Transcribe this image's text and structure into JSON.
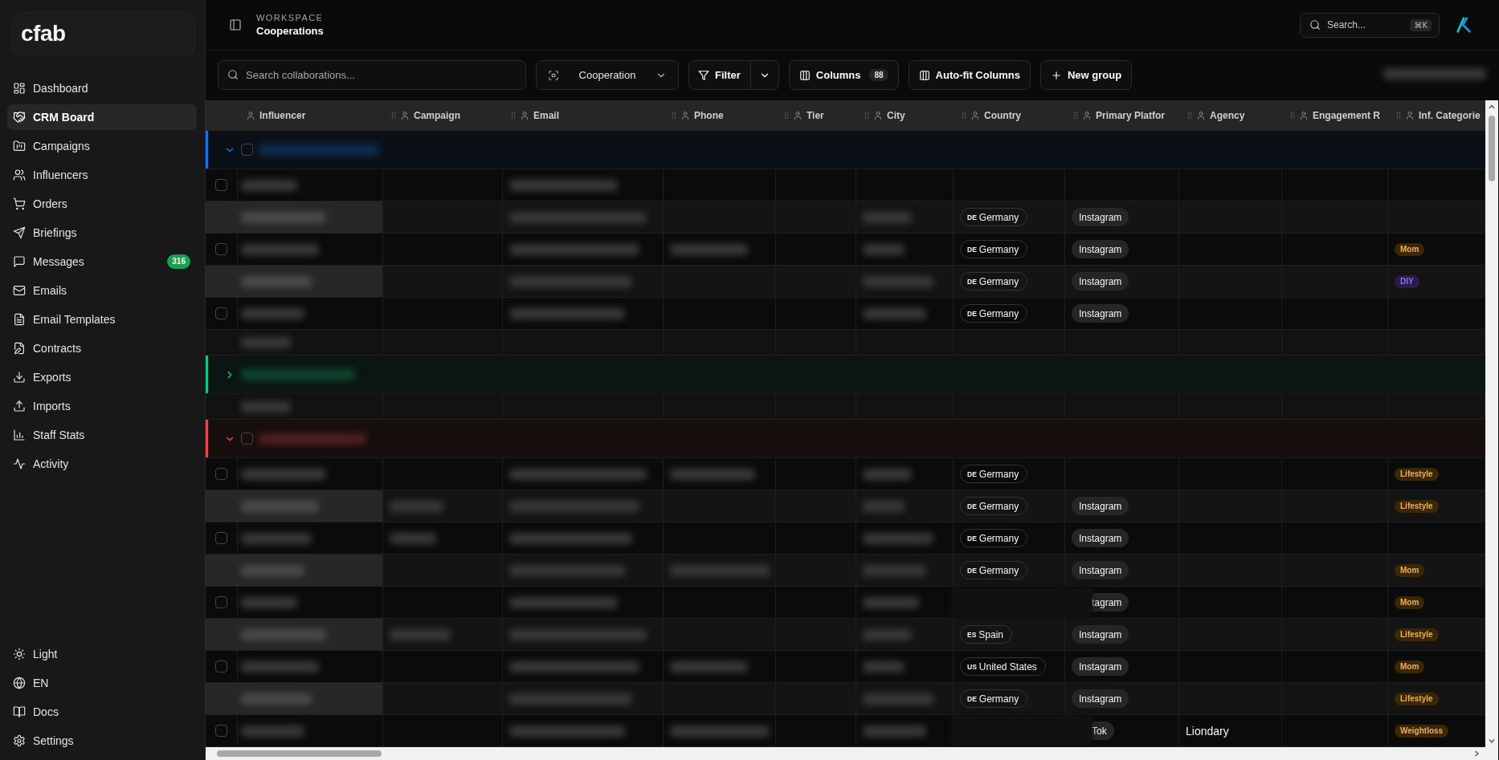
{
  "sidebar": {
    "logo": "cfab",
    "nav": [
      {
        "label": "Dashboard",
        "selected": false
      },
      {
        "label": "CRM Board",
        "selected": true
      },
      {
        "label": "Campaigns",
        "selected": false
      },
      {
        "label": "Influencers",
        "selected": false
      },
      {
        "label": "Orders",
        "selected": false
      },
      {
        "label": "Briefings",
        "selected": false
      },
      {
        "label": "Messages",
        "selected": false,
        "badge": "316"
      },
      {
        "label": "Emails",
        "selected": false
      },
      {
        "label": "Email Templates",
        "selected": false
      },
      {
        "label": "Contracts",
        "selected": false
      },
      {
        "label": "Exports",
        "selected": false
      },
      {
        "label": "Imports",
        "selected": false
      },
      {
        "label": "Staff Stats",
        "selected": false
      },
      {
        "label": "Activity",
        "selected": false
      }
    ],
    "footer": [
      {
        "label": "Light"
      },
      {
        "label": "EN"
      },
      {
        "label": "Docs"
      },
      {
        "label": "Settings"
      }
    ]
  },
  "header": {
    "eyebrow": "WORKSPACE",
    "title": "Cooperations",
    "search": {
      "placeholder": "Search...",
      "shortcut": "⌘K"
    }
  },
  "toolbar": {
    "search": {
      "placeholder": "Search collaborations..."
    },
    "view_select": {
      "value": "Cooperation"
    },
    "filter": {
      "label": "Filter"
    },
    "columns": {
      "label": "Columns",
      "count": "88"
    },
    "autofit": {
      "label": "Auto-fit Columns"
    },
    "new_group": {
      "label": "New group"
    },
    "status": {
      "blurred": true
    }
  },
  "table": {
    "columns": [
      {
        "label": "Influencer",
        "draggable": false
      },
      {
        "label": "Campaign",
        "draggable": true
      },
      {
        "label": "Email",
        "draggable": true
      },
      {
        "label": "Phone",
        "draggable": true
      },
      {
        "label": "Tier",
        "draggable": true
      },
      {
        "label": "City",
        "draggable": true
      },
      {
        "label": "Country",
        "draggable": true
      },
      {
        "label": "Primary Platfor",
        "draggable": true
      },
      {
        "label": "Agency",
        "draggable": true
      },
      {
        "label": "Engagement R",
        "draggable": true
      },
      {
        "label": "Inf. Categorie",
        "draggable": true
      }
    ],
    "groups": [
      {
        "color": "#1a73e8",
        "expanded": true,
        "checked": false,
        "name": {
          "blurred": true
        },
        "summary": {
          "blurred": true
        },
        "rows": [
          {
            "checked": false,
            "influencer": {
              "blurred": true
            },
            "email": {
              "blurred": true
            }
          },
          {
            "influencer": {
              "blurred": true
            },
            "email": {
              "blurred": true
            },
            "city": {
              "blurred": true
            },
            "country": {
              "code": "DE",
              "name": "Germany"
            },
            "platform": {
              "label": "Instagram"
            }
          },
          {
            "checked": false,
            "influencer": {
              "blurred": true
            },
            "email": {
              "blurred": true
            },
            "phone": {
              "blurred": true
            },
            "city": {
              "blurred": true
            },
            "country": {
              "code": "DE",
              "name": "Germany"
            },
            "platform": {
              "label": "Instagram"
            },
            "category": {
              "label": "Mom",
              "color": "#3b2608"
            }
          },
          {
            "influencer": {
              "blurred": true
            },
            "email": {
              "blurred": true
            },
            "city": {
              "blurred": true
            },
            "country": {
              "code": "DE",
              "name": "Germany"
            },
            "platform": {
              "label": "Instagram"
            },
            "category": {
              "label": "DIY",
              "color": "#2b1b52"
            }
          },
          {
            "checked": false,
            "influencer": {
              "blurred": true
            },
            "email": {
              "blurred": true
            },
            "city": {
              "blurred": true
            },
            "country": {
              "code": "DE",
              "name": "Germany"
            },
            "platform": {
              "label": "Instagram"
            }
          }
        ]
      },
      {
        "color": "#16c47f",
        "expanded": false,
        "name": {
          "blurred": true
        },
        "summary": {
          "blurred": true
        }
      },
      {
        "color": "#e5484d",
        "expanded": true,
        "checked": false,
        "name": {
          "blurred": true
        },
        "rows": [
          {
            "checked": false,
            "influencer": {
              "blurred": true
            },
            "email": {
              "blurred": true
            },
            "phone": {
              "blurred": true
            },
            "city": {
              "blurred": true
            },
            "country": {
              "code": "DE",
              "name": "Germany"
            },
            "category": {
              "label": "Lifestyle",
              "color": "#3b2608"
            }
          },
          {
            "influencer": {
              "blurred": true
            },
            "campaign": {
              "blurred": true
            },
            "email": {
              "blurred": true
            },
            "city": {
              "blurred": true
            },
            "country": {
              "code": "DE",
              "name": "Germany"
            },
            "platform": {
              "label": "Instagram"
            },
            "category": {
              "label": "Lifestyle",
              "color": "#3b2608"
            }
          },
          {
            "checked": false,
            "influencer": {
              "blurred": true
            },
            "campaign": {
              "blurred": true
            },
            "email": {
              "blurred": true
            },
            "city": {
              "blurred": true
            },
            "country": {
              "code": "DE",
              "name": "Germany"
            },
            "platform": {
              "label": "Instagram"
            }
          },
          {
            "influencer": {
              "blurred": true
            },
            "email": {
              "blurred": true
            },
            "phone": {
              "blurred": true
            },
            "city": {
              "blurred": true
            },
            "country": {
              "code": "DE",
              "name": "Germany"
            },
            "platform": {
              "label": "Instagram"
            },
            "category": {
              "label": "Mom",
              "color": "#3b2608"
            }
          },
          {
            "checked": false,
            "influencer": {
              "blurred": true
            },
            "email": {
              "blurred": true
            },
            "city": {
              "blurred": true
            },
            "country": {
              "covered": true
            },
            "platform": {
              "label": "tagram",
              "cut": true
            },
            "category": {
              "label": "Mom",
              "color": "#3b2608"
            }
          },
          {
            "influencer": {
              "blurred": true
            },
            "campaign": {
              "blurred": true
            },
            "email": {
              "blurred": true
            },
            "city": {
              "blurred": true
            },
            "country": {
              "code": "ES",
              "name": "Spain"
            },
            "platform": {
              "label": "Instagram"
            },
            "category": {
              "label": "Lifestyle",
              "color": "#3b2608"
            }
          },
          {
            "checked": false,
            "influencer": {
              "blurred": true
            },
            "email": {
              "blurred": true
            },
            "phone": {
              "blurred": true
            },
            "city": {
              "blurred": true
            },
            "country": {
              "code": "US",
              "name": "United States"
            },
            "platform": {
              "label": "Instagram"
            },
            "category": {
              "label": "Mom",
              "color": "#3b2608"
            }
          },
          {
            "influencer": {
              "blurred": true
            },
            "email": {
              "blurred": true
            },
            "city": {
              "blurred": true
            },
            "country": {
              "code": "DE",
              "name": "Germany"
            },
            "platform": {
              "label": "Instagram"
            },
            "category": {
              "label": "Lifestyle",
              "color": "#3b2608"
            }
          },
          {
            "checked": false,
            "influencer": {
              "blurred": true
            },
            "email": {
              "blurred": true
            },
            "phone": {
              "blurred": true
            },
            "city": {
              "blurred": true
            },
            "country": {
              "covered": true
            },
            "platform": {
              "label": "Tok",
              "cut": true
            },
            "agency": "Liondary",
            "category": {
              "label": "Weightloss",
              "color": "#3b2608"
            }
          }
        ]
      }
    ]
  }
}
